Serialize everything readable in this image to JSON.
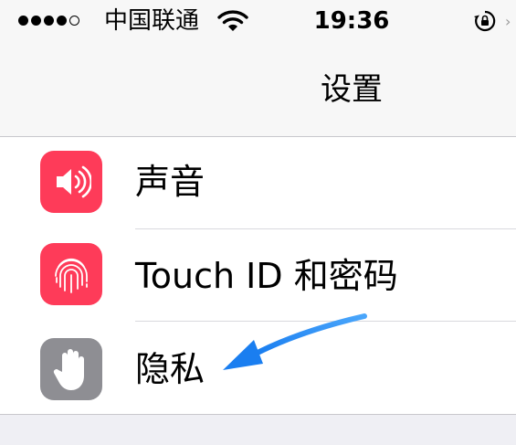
{
  "status_bar": {
    "signal_bars": 4,
    "signal_total": 5,
    "carrier": "中国联通",
    "time": "19:36",
    "wifi_icon": "wifi-icon",
    "lock_icon": "rotation-lock-icon"
  },
  "nav": {
    "title": "设置"
  },
  "settings": {
    "items": [
      {
        "label": "声音",
        "icon": "speaker-icon",
        "icon_color": "#fe3b59"
      },
      {
        "label": "Touch ID 和密码",
        "icon": "fingerprint-icon",
        "icon_color": "#fe3b59"
      },
      {
        "label": "隐私",
        "icon": "hand-icon",
        "icon_color": "#8e8e93"
      }
    ]
  },
  "annotation": {
    "icon": "blue-arrow-icon",
    "color": "#2a8ff7"
  }
}
